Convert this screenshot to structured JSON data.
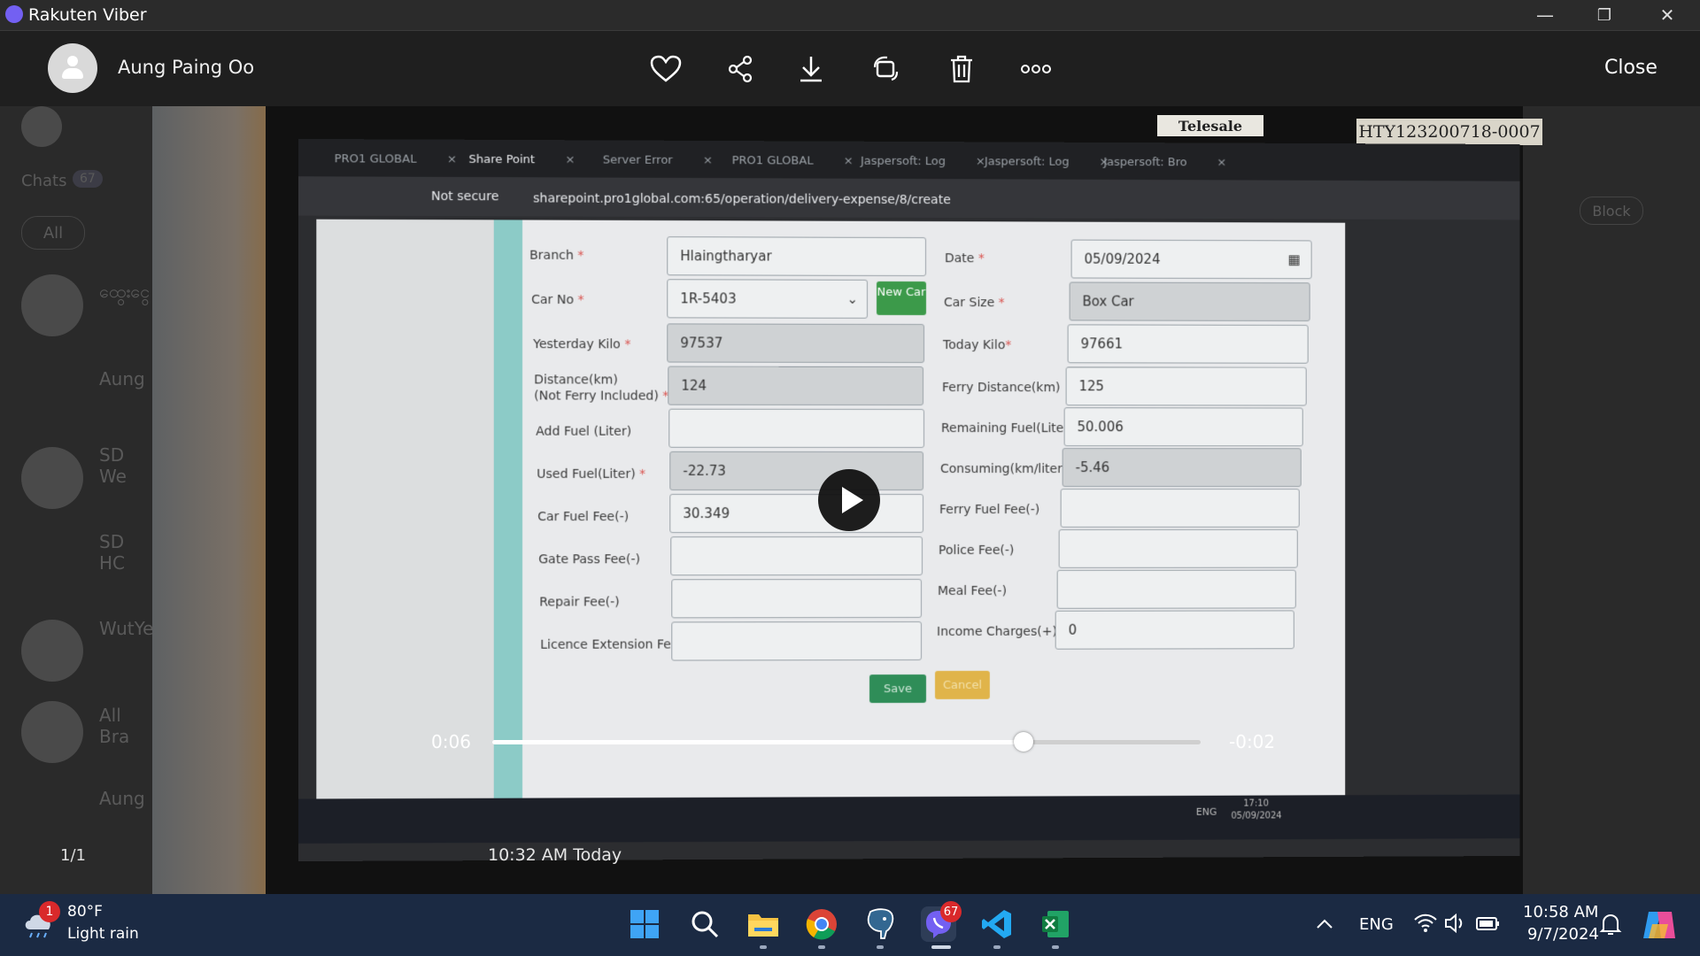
{
  "window": {
    "title": "Rakuten Viber",
    "controls": {
      "minimize": "—",
      "restore": "❐",
      "close": "✕"
    }
  },
  "viewer": {
    "sender_name": "Aung Paing Oo",
    "close_label": "Close",
    "counter": "1/1",
    "message_time": "10:32 AM Today",
    "toolbar_icons": [
      "heart-icon",
      "share-icon",
      "download-icon",
      "rotate-icon",
      "trash-icon",
      "more-icon"
    ]
  },
  "player": {
    "current_time": "0:06",
    "remaining_time": "-0:02",
    "progress": 0.75
  },
  "background": {
    "chats_label": "Chats",
    "chats_count": "67",
    "all_label": "All",
    "rows": [
      "ထွေးငွေ",
      "Aung",
      "SD We",
      "SD HC",
      "WutYe",
      "All Bra",
      "Aung"
    ],
    "block_label": "Block"
  },
  "photo": {
    "telesale_label": "Telesale",
    "serial_label": "HTY123200718-0007",
    "browser": {
      "tabs": [
        "PRO1 GLOBAL",
        "Share Point",
        "Server Error",
        "PRO1 GLOBAL",
        "Jaspersoft: Log",
        "Jaspersoft: Log",
        "Jaspersoft: Bro"
      ],
      "not_secure": "Not secure",
      "url": "sharepoint.pro1global.com:65/operation/delivery-expense/8/create"
    },
    "form": {
      "branch": {
        "label": "Branch",
        "value": "Hlaingtharyar"
      },
      "date": {
        "label": "Date",
        "value": "05/09/2024"
      },
      "car_no": {
        "label": "Car No",
        "value": "1R-5403"
      },
      "new_car": "New Car",
      "car_size": {
        "label": "Car Size",
        "value": "Box Car"
      },
      "yesterday_kilo": {
        "label": "Yesterday Kilo",
        "value": "97537"
      },
      "today_kilo": {
        "label": "Today Kilo",
        "value": "97661"
      },
      "distance": {
        "label": "Distance(km)",
        "label2": "(Not Ferry Included)",
        "value": "124"
      },
      "ferry_distance": {
        "label": "Ferry Distance(km)",
        "value": "125"
      },
      "add_fuel": {
        "label": "Add Fuel (Liter)",
        "value": ""
      },
      "remaining_fuel": {
        "label": "Remaining Fuel(Liter)",
        "value": "50.006"
      },
      "used_fuel": {
        "label": "Used Fuel(Liter)",
        "value": "-22.73"
      },
      "consuming": {
        "label": "Consuming(km/liter)",
        "value": "-5.46"
      },
      "car_fuel_fee": {
        "label": "Car Fuel Fee(-)",
        "value": "30.349"
      },
      "ferry_fuel_fee": {
        "label": "Ferry Fuel Fee(-)",
        "value": ""
      },
      "gate_pass_fee": {
        "label": "Gate Pass Fee(-)",
        "value": ""
      },
      "police_fee": {
        "label": "Police Fee(-)",
        "value": ""
      },
      "repair_fee": {
        "label": "Repair Fee(-)",
        "value": ""
      },
      "meal_fee": {
        "label": "Meal Fee(-)",
        "value": ""
      },
      "licence_fee": {
        "label": "Licence Extension Fee(-)",
        "value": ""
      },
      "income_charges": {
        "label": "Income Charges(+)",
        "value": "0"
      },
      "save": "Save",
      "cancel": "Cancel"
    },
    "screen_clock": {
      "time": "17:10",
      "date": "05/09/2024"
    },
    "screen_lang": "ENG"
  },
  "taskbar": {
    "weather_badge": "1",
    "temperature": "80°F",
    "weather": "Light rain",
    "viber_badge": "67",
    "language": "ENG",
    "time": "10:58 AM",
    "date": "9/7/2024",
    "apps": [
      "windows-start-icon",
      "search-icon",
      "file-explorer-icon",
      "chrome-icon",
      "postgres-icon",
      "viber-icon",
      "vscode-icon",
      "excel-icon"
    ]
  }
}
